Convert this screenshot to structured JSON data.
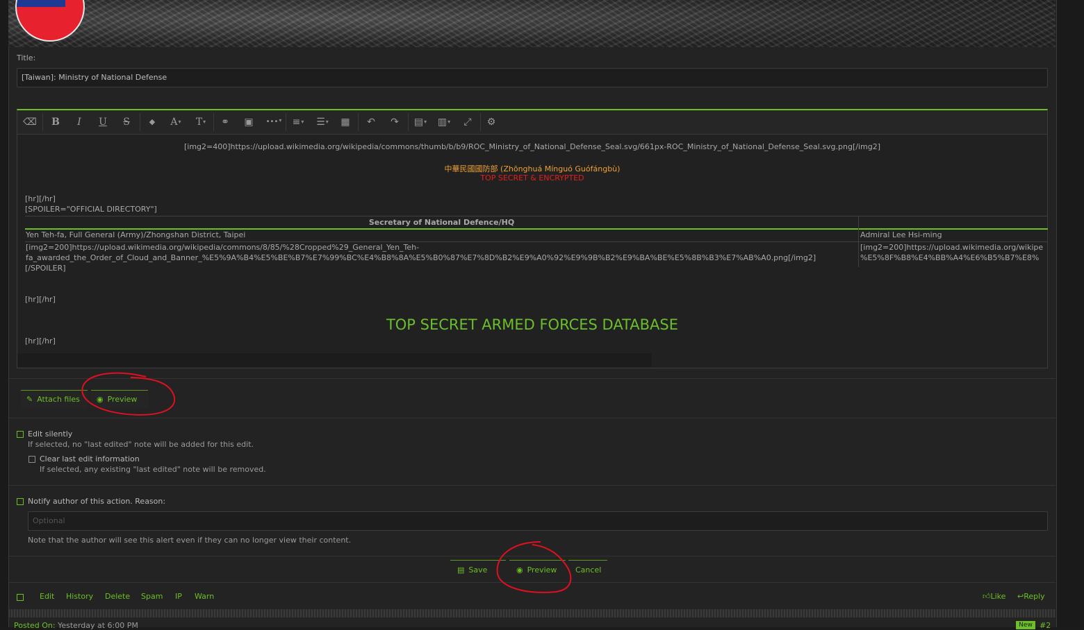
{
  "form": {
    "title_label": "Title:",
    "title_value": "[Taiwan]: Ministry of National Defense"
  },
  "toolbar": {
    "icons": [
      "eraser-icon",
      "bold-icon",
      "italic-icon",
      "underline-icon",
      "strikethrough-icon",
      "text-color-icon",
      "font-size-icon",
      "font-family-icon",
      "link-icon",
      "image-icon",
      "more-icon",
      "align-icon",
      "list-icon",
      "table-icon",
      "undo-icon",
      "redo-icon",
      "drafts-icon",
      "paste-icon",
      "fullscreen-icon",
      "settings-icon"
    ],
    "bold": "B",
    "italic": "I",
    "underline": "U",
    "strike": "S",
    "font_size": "A",
    "font_family": "T",
    "caret": "▾",
    "drop": "◆",
    "link": "⚭",
    "image": "▣",
    "more": "•••",
    "align": "≡",
    "list": "☰",
    "table": "▦",
    "undo": "↶",
    "redo": "↷",
    "save_draft": "▤",
    "paste": "▥",
    "fullscreen": "⤢",
    "settings": "⚙",
    "eraser": "⌫"
  },
  "editor": {
    "img_line": "[img2=400]https://upload.wikimedia.org/wikipedia/commons/thumb/b/b9/ROC_Ministry_of_National_Defense_Seal.svg/661px-ROC_Ministry_of_National_Defense_Seal.svg.png[/img2]",
    "chinese_name": "中華民國國防部 (Zhōnghuá Mínguó Guófángbù)",
    "classification": "TOP SECRET & ENCRYPTED",
    "hr1": "[hr][/hr]",
    "spoiler_open": "[SPOILER=\"OFFICIAL DIRECTORY\"]",
    "table_header": "Secretary of National Defence/HQ",
    "cell_1": "Yen Teh-fa, Full General (Army)/Zhongshan District, Taipei",
    "cell_2": "Admiral Lee Hsi-ming",
    "cell_3_line1": "[img2=200]https://upload.wikimedia.org/wikipedia/commons/8/85/%28Cropped%29_General_Yen_Teh-",
    "cell_3_line2": "fa_awarded_the_Order_of_Cloud_and_Banner_%E5%9A%B4%E5%BE%B7%E7%99%BC%E4%B8%8A%E5%B0%87%E7%8D%B2%E9%A0%92%E9%9B%B2%E9%BA%BE%E5%8B%B3%E7%AB%A0.png[/img2]",
    "cell_4_line1": "[img2=200]https://upload.wikimedia.org/wikipe",
    "cell_4_line2": "%E5%8F%B8%E4%BB%A4%E6%B5%B7%E8%",
    "spoiler_close": "[/SPOILER]",
    "hr2": "[hr][/hr]",
    "database_title": "TOP SECRET ARMED FORCES DATABASE",
    "hr3": "[hr][/hr]"
  },
  "attachments": {
    "attach_label": "Attach files",
    "preview_label": "Preview"
  },
  "options": {
    "edit_silently": "Edit silently",
    "edit_silently_hint": "If selected, no \"last edited\" note will be added for this edit.",
    "clear_last_edit": "Clear last edit information",
    "clear_last_edit_hint": "If selected, any existing \"last edited\" note will be removed.",
    "notify_author": "Notify author of this action. Reason:",
    "reason_placeholder": "Optional",
    "notify_hint": "Note that the author will see this alert even if they can no longer view their content."
  },
  "buttons": {
    "save": "Save",
    "preview": "Preview",
    "cancel": "Cancel"
  },
  "post_actions": {
    "edit": "Edit",
    "history": "History",
    "delete": "Delete",
    "spam": "Spam",
    "ip": "IP",
    "warn": "Warn",
    "like": "Like",
    "reply": "Reply"
  },
  "next_post": {
    "posted_label": "Posted On:",
    "posted_time": "Yesterday at 6:00 PM",
    "badge": "New",
    "number": "#2"
  },
  "colors": {
    "accent": "#6cc024",
    "background": "#232323",
    "annotation": "#e01020",
    "classification": "#e02020",
    "chinese_name": "#f0a030"
  }
}
